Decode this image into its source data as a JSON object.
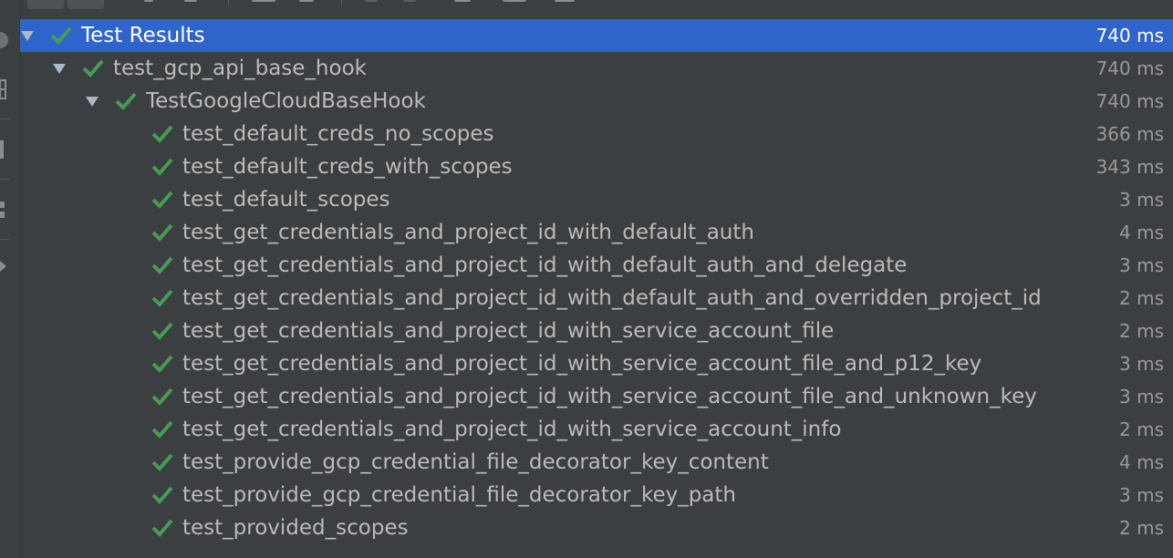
{
  "colors": {
    "background": "#3c3f41",
    "selection": "#2f65ca",
    "pass_green": "#499c54",
    "text": "#bbbbbb",
    "time_text": "#999999"
  },
  "icons": {
    "expand": "triangle-down-icon",
    "pass": "check-icon"
  },
  "tree": {
    "root": {
      "label": "Test Results",
      "time": "740 ms"
    },
    "module": {
      "label": "test_gcp_api_base_hook",
      "time": "740 ms"
    },
    "class": {
      "label": "TestGoogleCloudBaseHook",
      "time": "740 ms"
    },
    "tests": [
      {
        "label": "test_default_creds_no_scopes",
        "time": "366 ms"
      },
      {
        "label": "test_default_creds_with_scopes",
        "time": "343 ms"
      },
      {
        "label": "test_default_scopes",
        "time": "3 ms"
      },
      {
        "label": "test_get_credentials_and_project_id_with_default_auth",
        "time": "4 ms"
      },
      {
        "label": "test_get_credentials_and_project_id_with_default_auth_and_delegate",
        "time": "3 ms"
      },
      {
        "label": "test_get_credentials_and_project_id_with_default_auth_and_overridden_project_id",
        "time": "2 ms"
      },
      {
        "label": "test_get_credentials_and_project_id_with_service_account_file",
        "time": "2 ms"
      },
      {
        "label": "test_get_credentials_and_project_id_with_service_account_file_and_p12_key",
        "time": "3 ms"
      },
      {
        "label": "test_get_credentials_and_project_id_with_service_account_file_and_unknown_key",
        "time": "3 ms"
      },
      {
        "label": "test_get_credentials_and_project_id_with_service_account_info",
        "time": "2 ms"
      },
      {
        "label": "test_provide_gcp_credential_file_decorator_key_content",
        "time": "4 ms"
      },
      {
        "label": "test_provide_gcp_credential_file_decorator_key_path",
        "time": "3 ms"
      },
      {
        "label": "test_provided_scopes",
        "time": "2 ms"
      }
    ]
  }
}
